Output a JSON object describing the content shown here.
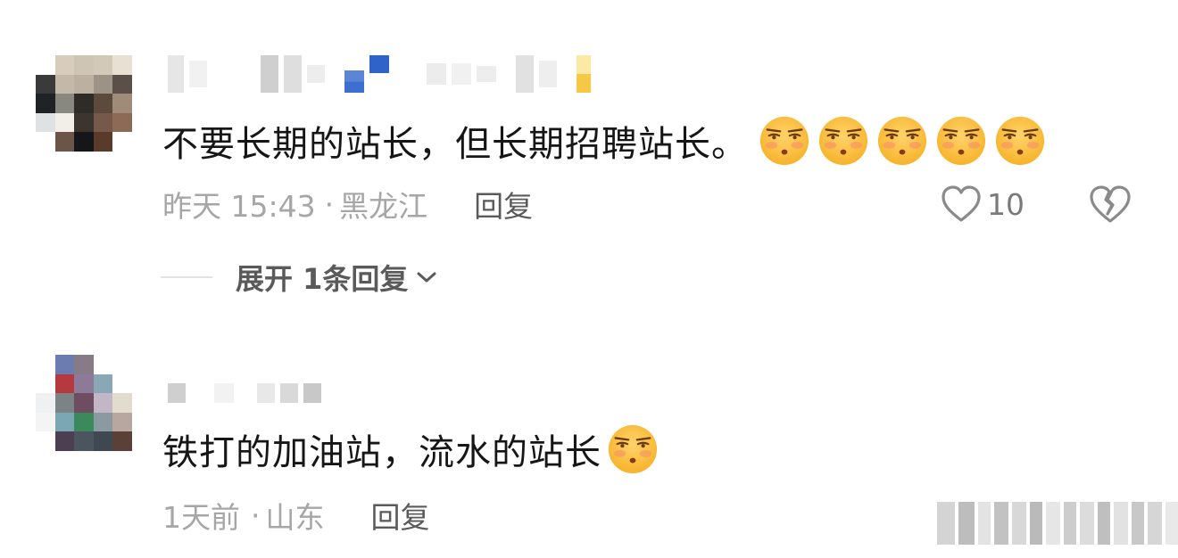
{
  "comments": [
    {
      "text": "不要长期的站长，但长期招聘站长。",
      "emoji_count": 5,
      "emoji_name": "frown-face-emoji",
      "time": "昨天 15:43",
      "location": "黑龙江",
      "meta_sep": "·",
      "reply_label": "回复",
      "likes": "10",
      "expand_label": "展开 1条回复"
    },
    {
      "text": "铁打的加油站，流水的站长",
      "emoji_count": 1,
      "emoji_name": "frown-face-emoji",
      "time": "1天前",
      "location": "山东",
      "meta_sep": "·",
      "reply_label": "回复"
    }
  ],
  "colors": {
    "text": "#161616",
    "meta": "#a6a6a6",
    "reply": "#5a5a5a",
    "emoji_face": "#f7b32b"
  }
}
